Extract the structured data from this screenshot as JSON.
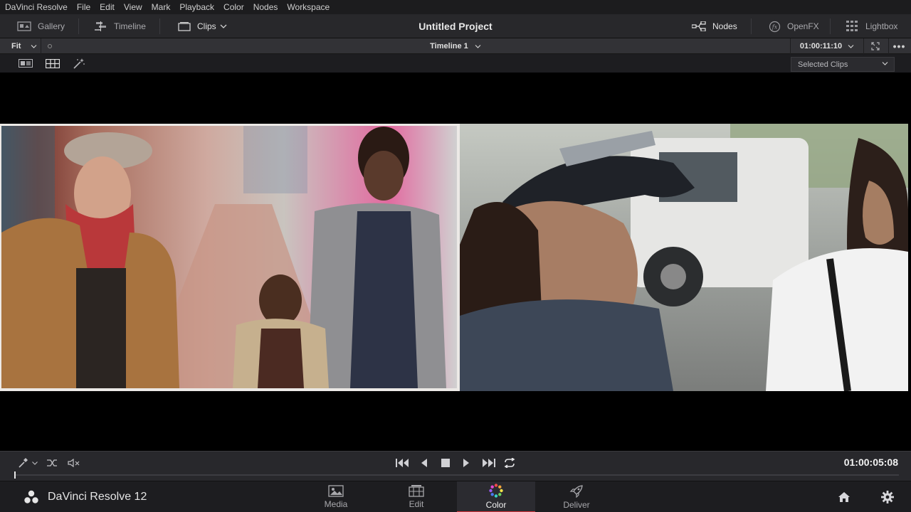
{
  "menubar": {
    "items": [
      "DaVinci Resolve",
      "File",
      "Edit",
      "View",
      "Mark",
      "Playback",
      "Color",
      "Nodes",
      "Workspace"
    ]
  },
  "toolbar": {
    "gallery": "Gallery",
    "timeline": "Timeline",
    "clips": "Clips",
    "project_title": "Untitled Project",
    "nodes": "Nodes",
    "openfx": "OpenFX",
    "lightbox": "Lightbox"
  },
  "viewer_bar": {
    "fit": "Fit",
    "timeline_name": "Timeline 1",
    "timecode": "01:00:11:10",
    "more": "•••"
  },
  "sub_bar": {
    "selected_clips": "Selected Clips"
  },
  "transport": {
    "timecode": "01:00:05:08"
  },
  "page_bar": {
    "app_name": "DaVinci Resolve 12",
    "tabs": [
      {
        "label": "Media"
      },
      {
        "label": "Edit"
      },
      {
        "label": "Color"
      },
      {
        "label": "Deliver"
      }
    ],
    "active_tab": "Color"
  },
  "colors": {
    "accent_red": "#d6343c",
    "panel": "#28282b",
    "viewer_bg": "#000000"
  }
}
